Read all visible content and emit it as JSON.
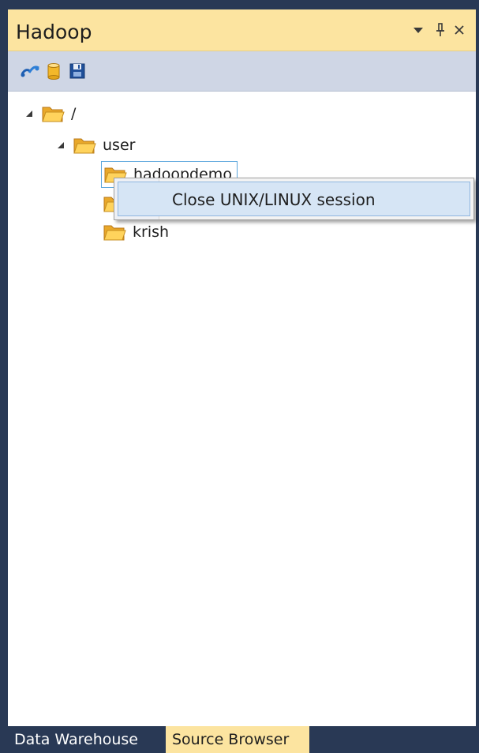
{
  "window": {
    "title": "Hadoop",
    "dropdown_icon": "▾",
    "pin_icon": "ᛒ",
    "close_icon": "✕"
  },
  "toolbar": {
    "tools": [
      "connect-icon",
      "database-icon",
      "save-icon"
    ]
  },
  "tree": {
    "root": {
      "label": "/"
    },
    "user": {
      "label": "user"
    },
    "hadoopdemo": {
      "label": "hadoopdemo"
    },
    "hidden_item": {
      "label": ""
    },
    "krish": {
      "label": "krish"
    }
  },
  "context_menu": {
    "items": [
      {
        "label": "Close UNIX/LINUX session"
      }
    ]
  },
  "tabs": [
    {
      "label": "Data Warehouse",
      "active": false
    },
    {
      "label": "Source Browser",
      "active": true
    }
  ],
  "colors": {
    "title_bar": "#fce4a0",
    "toolbar": "#cfd6e5",
    "frame": "#293955",
    "selection_border": "#5aa5dc",
    "menu_highlight": "#d6e5f5"
  }
}
